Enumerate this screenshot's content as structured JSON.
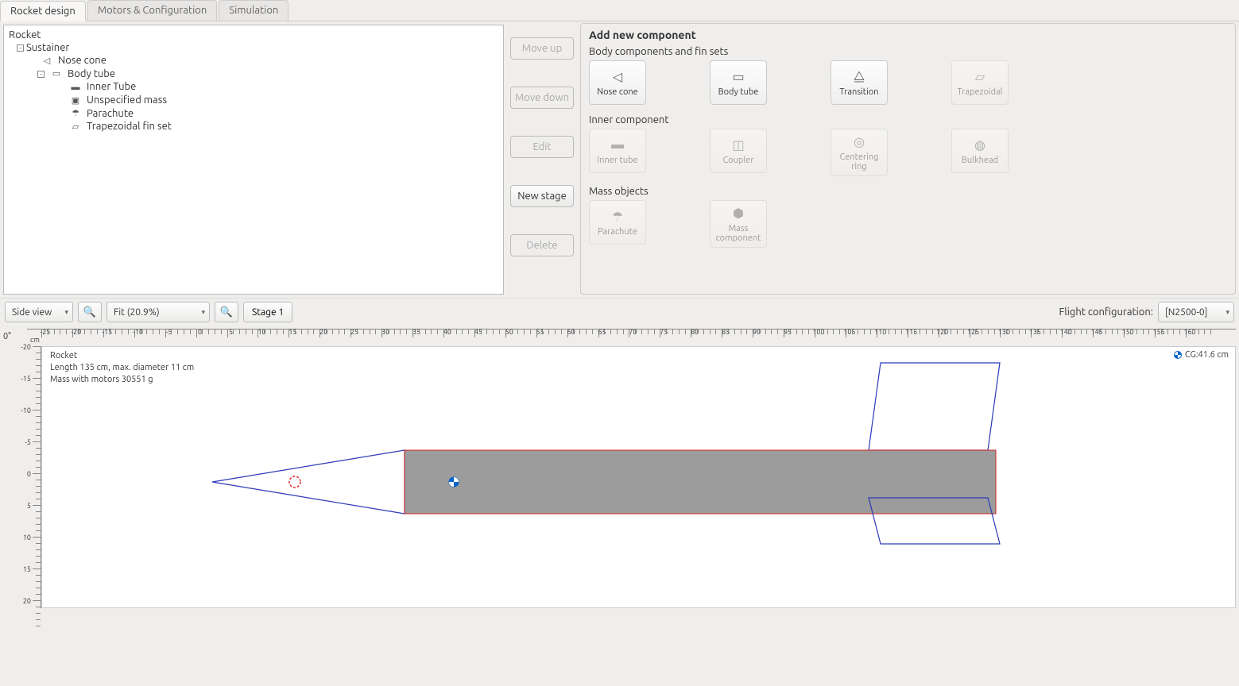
{
  "tabs": [
    {
      "label": "Rocket design",
      "active": true
    },
    {
      "label": "Motors & Configuration",
      "active": false
    },
    {
      "label": "Simulation",
      "active": false
    }
  ],
  "tree": {
    "root": "Rocket",
    "sustainer": "Sustainer",
    "nose_cone": "Nose cone",
    "body_tube": "Body tube",
    "inner_tube": "Inner Tube",
    "unspecified_mass": "Unspecified mass",
    "parachute": "Parachute",
    "trap_fin": "Trapezoidal fin set"
  },
  "actions": {
    "move_up": "Move up",
    "move_down": "Move down",
    "edit": "Edit",
    "new_stage": "New stage",
    "delete": "Delete"
  },
  "palette": {
    "title": "Add new component",
    "section_body": "Body components and fin sets",
    "section_inner": "Inner component",
    "section_mass": "Mass objects",
    "nose_cone": "Nose cone",
    "body_tube": "Body tube",
    "transition": "Transition",
    "trapezoidal": "Trapezoidal",
    "inner_tube": "Inner tube",
    "coupler": "Coupler",
    "centering_ring": "Centering ring",
    "bulkhead": "Bulkhead",
    "parachute": "Parachute",
    "mass_component": "Mass component"
  },
  "toolbar": {
    "view_mode": "Side view",
    "zoom": "Fit (20.9%)",
    "stage": "Stage 1",
    "flight_config_label": "Flight configuration:",
    "flight_config_value": "[N2500-0]"
  },
  "canvas": {
    "angle": "0°",
    "cm": "cm",
    "name": "Rocket",
    "dims": "Length 135 cm, max. diameter 11 cm",
    "mass": "Mass with motors 30551 g",
    "cg": "CG:41.6 cm"
  },
  "ruler_h": [
    -25,
    -20,
    -15,
    -10,
    -5,
    0,
    5,
    10,
    15,
    20,
    25,
    30,
    35,
    40,
    45,
    50,
    55,
    60,
    65,
    70,
    75,
    80,
    85,
    90,
    95,
    100,
    105,
    110,
    115,
    120,
    125,
    130,
    135,
    140,
    145,
    150,
    155,
    160
  ],
  "ruler_v": [
    -20,
    -15,
    -10,
    -5,
    0,
    5,
    10,
    15,
    20
  ]
}
